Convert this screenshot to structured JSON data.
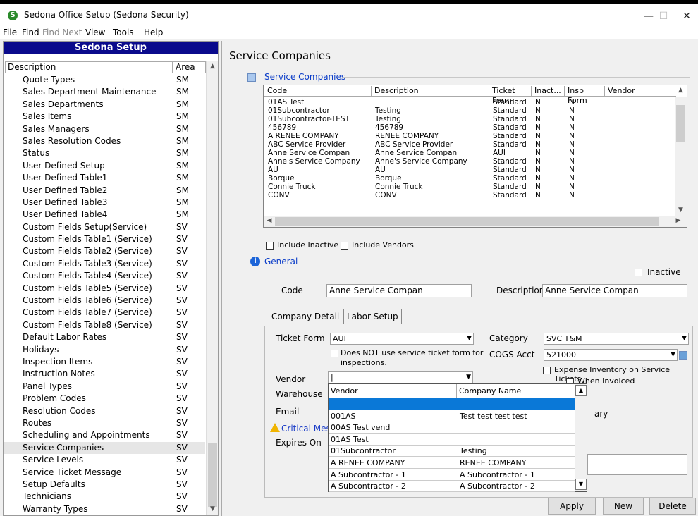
{
  "window": {
    "title": "Sedona Office Setup (Sedona Security)",
    "minimize": "—",
    "maximize": "☐",
    "close": "✕"
  },
  "menu": [
    "File",
    "Find",
    "Find Next",
    "View",
    "Tools",
    "Help"
  ],
  "left_panel": {
    "header": "Sedona Setup",
    "col_description": "Description",
    "col_area": "Area",
    "items": [
      {
        "d": "Quote Types",
        "a": "SM"
      },
      {
        "d": "Sales Department Maintenance",
        "a": "SM"
      },
      {
        "d": "Sales Departments",
        "a": "SM"
      },
      {
        "d": "Sales Items",
        "a": "SM"
      },
      {
        "d": "Sales Managers",
        "a": "SM"
      },
      {
        "d": "Sales Resolution Codes",
        "a": "SM"
      },
      {
        "d": "Status",
        "a": "SM"
      },
      {
        "d": "User Defined Setup",
        "a": "SM"
      },
      {
        "d": "User Defined Table1",
        "a": "SM"
      },
      {
        "d": "User Defined Table2",
        "a": "SM"
      },
      {
        "d": "User Defined Table3",
        "a": "SM"
      },
      {
        "d": "User Defined Table4",
        "a": "SM"
      },
      {
        "d": "Custom Fields Setup(Service)",
        "a": "SV"
      },
      {
        "d": "Custom Fields Table1 (Service)",
        "a": "SV"
      },
      {
        "d": "Custom Fields Table2 (Service)",
        "a": "SV"
      },
      {
        "d": "Custom Fields Table3 (Service)",
        "a": "SV"
      },
      {
        "d": "Custom Fields Table4 (Service)",
        "a": "SV"
      },
      {
        "d": "Custom Fields Table5 (Service)",
        "a": "SV"
      },
      {
        "d": "Custom Fields Table6 (Service)",
        "a": "SV"
      },
      {
        "d": "Custom Fields Table7 (Service)",
        "a": "SV"
      },
      {
        "d": "Custom Fields Table8 (Service)",
        "a": "SV"
      },
      {
        "d": "Default Labor Rates",
        "a": "SV"
      },
      {
        "d": "Holidays",
        "a": "SV"
      },
      {
        "d": "Inspection Items",
        "a": "SV"
      },
      {
        "d": "Instruction Notes",
        "a": "SV"
      },
      {
        "d": "Panel Types",
        "a": "SV"
      },
      {
        "d": "Problem Codes",
        "a": "SV"
      },
      {
        "d": "Resolution Codes",
        "a": "SV"
      },
      {
        "d": "Routes",
        "a": "SV"
      },
      {
        "d": "Scheduling and Appointments",
        "a": "SV"
      },
      {
        "d": "Service Companies",
        "a": "SV"
      },
      {
        "d": "Service Levels",
        "a": "SV"
      },
      {
        "d": "Service Ticket Message",
        "a": "SV"
      },
      {
        "d": "Setup Defaults",
        "a": "SV"
      },
      {
        "d": "Technicians",
        "a": "SV"
      },
      {
        "d": "Warranty Types",
        "a": "SV"
      }
    ]
  },
  "main": {
    "title": "Service Companies",
    "section_companies": "Service Companies",
    "grid_headers": [
      "Code",
      "Description",
      "Ticket Form",
      "Inact...",
      "Insp Form",
      "Vendor"
    ],
    "grid_rows": [
      [
        "01AS Test",
        "",
        "Standard",
        "N",
        "N"
      ],
      [
        "01Subcontractor",
        "Testing",
        "Standard",
        "N",
        "N"
      ],
      [
        "01Subcontractor-TEST",
        "Testing",
        "Standard",
        "N",
        "N"
      ],
      [
        "456789",
        "456789",
        "Standard",
        "N",
        "N"
      ],
      [
        "A RENEE COMPANY",
        "RENEE COMPANY",
        "Standard",
        "N",
        "N"
      ],
      [
        "ABC Service Provider",
        "ABC Service Provider",
        "Standard",
        "N",
        "N"
      ],
      [
        "Anne Service Compan",
        "Anne Service Compan",
        "AUI",
        "N",
        "N"
      ],
      [
        "Anne's Service Company",
        "Anne's Service Company",
        "Standard",
        "N",
        "N"
      ],
      [
        "AU",
        "AU",
        "Standard",
        "N",
        "N"
      ],
      [
        "Borque",
        "Borque",
        "Standard",
        "N",
        "N"
      ],
      [
        "Connie Truck",
        "Connie Truck",
        "Standard",
        "N",
        "N"
      ],
      [
        "CONV",
        "CONV",
        "Standard",
        "N",
        "N"
      ]
    ],
    "include_inactive": "Include Inactive",
    "include_vendors": "Include Vendors",
    "section_general": "General",
    "inactive": "Inactive",
    "code_label": "Code",
    "code_value": "Anne Service Compan",
    "description_label": "Description",
    "description_value": "Anne Service Compan",
    "tab_company_detail": "Company Detail",
    "tab_labor_setup": "Labor Setup",
    "ticket_form_label": "Ticket Form",
    "ticket_form_value": "AUI",
    "not_use_line1": "Does NOT use service ticket form for",
    "not_use_line2": "inspections.",
    "category_label": "Category",
    "category_value": "SVC T&M",
    "cogs_label": "COGS Acct",
    "cogs_value": "521000",
    "expense_inventory": "Expense Inventory on Service Tickets",
    "when_invoiced": "When Invoiced",
    "vendor_label": "Vendor",
    "warehouse_label": "Warehouse",
    "email_label": "Email",
    "critical_label": "Critical Mes",
    "expires_label": "Expires On",
    "partial_label": "ary",
    "popup_headers": [
      "Vendor",
      "Company Name"
    ],
    "popup_rows": [
      [
        "",
        ""
      ],
      [
        "001AS",
        "Test test test test"
      ],
      [
        "00AS Test vend",
        ""
      ],
      [
        "01AS Test",
        ""
      ],
      [
        "01Subcontractor",
        "Testing"
      ],
      [
        "A RENEE COMPANY",
        "RENEE COMPANY"
      ],
      [
        "A Subcontractor - 1",
        "A Subcontractor - 1"
      ],
      [
        "A Subcontractor - 2",
        "A Subcontractor - 2"
      ]
    ],
    "apply": "Apply",
    "new": "New",
    "delete": "Delete"
  }
}
